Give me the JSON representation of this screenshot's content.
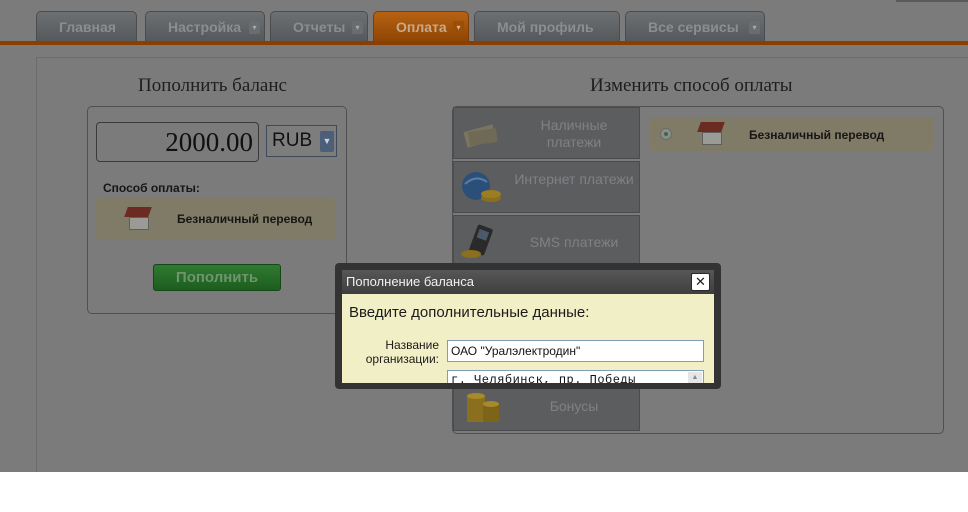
{
  "nav": {
    "tabs": [
      {
        "label": "Главная",
        "dropdown": false,
        "active": false
      },
      {
        "label": "Настройка",
        "dropdown": true,
        "active": false
      },
      {
        "label": "Отчеты",
        "dropdown": true,
        "active": false
      },
      {
        "label": "Оплата",
        "dropdown": true,
        "active": true
      },
      {
        "label": "Мой профиль",
        "dropdown": false,
        "active": false
      },
      {
        "label": "Все сервисы",
        "dropdown": true,
        "active": false
      }
    ],
    "dropdown_glyph": "▾"
  },
  "topup": {
    "heading": "Пополнить баланс",
    "amount": "2000.00",
    "currency": "RUB",
    "method_label": "Способ оплаты:",
    "selected_method": "Безналичный перевод",
    "button_label": "Пополнить"
  },
  "change_method": {
    "heading": "Изменить способ оплаты",
    "methods": [
      {
        "label": "Наличные платежи",
        "icon": "cash-icon"
      },
      {
        "label": "Интернет платежи",
        "icon": "globe-coins-icon"
      },
      {
        "label": "SMS платежи",
        "icon": "mobile-phone-icon"
      },
      {
        "label": "Бонусы",
        "icon": "coin-stack-icon"
      }
    ],
    "selected": "Безналичный перевод",
    "selected_icon": "house-icon"
  },
  "modal": {
    "title": "Пополнение баланса",
    "close_glyph": "✕",
    "prompt": "Введите дополнительные данные:",
    "org_label": "Название организации:",
    "org_value": "ОАО \"Уралэлектродин\"",
    "address_value": "г. Челябинск, пр. Победы"
  },
  "colors": {
    "accent": "#b76212",
    "nav_line": "#8a3f00",
    "button_green": "#2f7a30",
    "modal_body": "#f0efc6",
    "overlay": "#7b7b7b"
  }
}
